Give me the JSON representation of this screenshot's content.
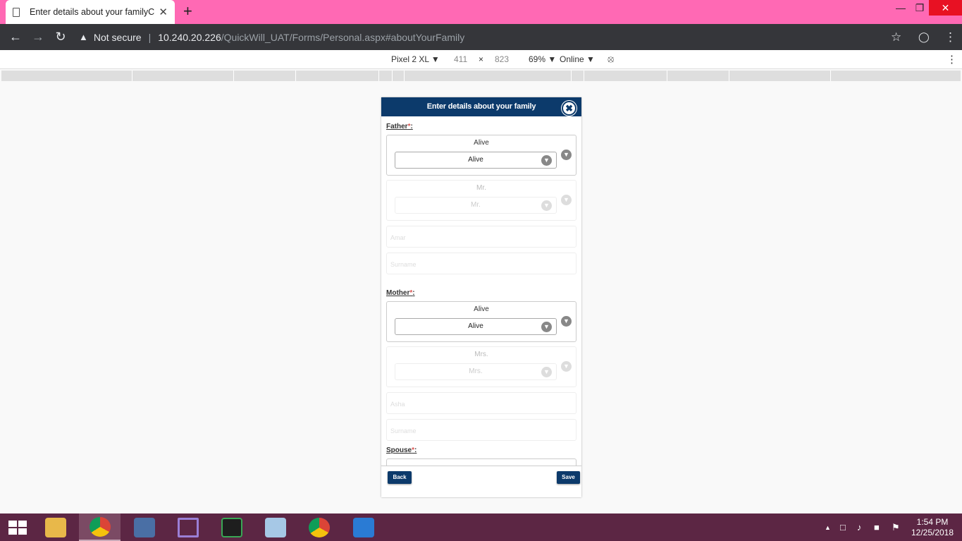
{
  "browser": {
    "tab_title": "Enter details about your familyCl",
    "tab_close": "✕",
    "new_tab": "+",
    "security_label": "Not secure",
    "url_host": "10.240.20.226",
    "url_path": "/QuickWill_UAT/Forms/Personal.aspx#aboutYourFamily"
  },
  "devtools": {
    "device": "Pixel 2 XL ▼",
    "width": "411",
    "times": "×",
    "height": "823",
    "zoom": "69% ▼",
    "network": "Online ▼"
  },
  "modal": {
    "title": "Enter details about your family",
    "close_glyph": "✖",
    "father": {
      "label": "Father",
      "required": "*",
      "status_caption": "Alive",
      "status_value": "Alive",
      "title_caption": "Mr.",
      "title_value": "Mr.",
      "first_name_placeholder": "Amar",
      "surname_placeholder": "Surname"
    },
    "mother": {
      "label": "Mother",
      "required": "*",
      "status_caption": "Alive",
      "status_value": "Alive",
      "title_caption": "Mrs.",
      "title_value": "Mrs.",
      "first_name_placeholder": "Asha",
      "surname_placeholder": "Surname"
    },
    "spouse": {
      "label": "Spouse",
      "required": "*"
    },
    "back_label": "Back",
    "save_label": "Save"
  },
  "taskbar": {
    "time": "1:54 PM",
    "date": "12/25/2018"
  },
  "colors": {
    "tab_strip": "#ff69b4",
    "modal_header": "#0c3a6b",
    "taskbar": "#5c2644"
  }
}
